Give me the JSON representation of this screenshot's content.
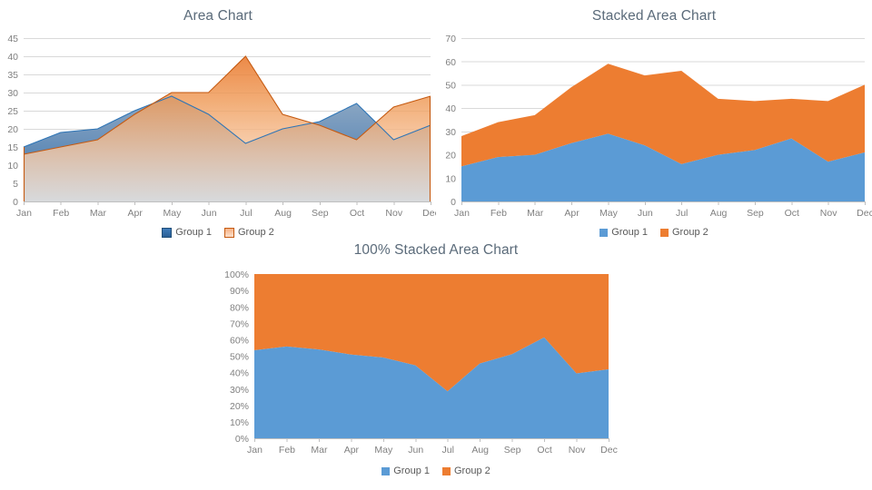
{
  "colors": {
    "series1_solid": "#5b9bd5",
    "series2_solid": "#ed7d31",
    "series1_line": "#2e75b6",
    "series2_line": "#c55a11",
    "grid": "#d9d9d9",
    "axis": "#bfbfbf",
    "title_text": "#5b6b7a",
    "tick_text": "#808080"
  },
  "charts": {
    "area": {
      "title": "Area Chart",
      "legend": [
        {
          "label": "Group 1",
          "swatch": "gradient-blue-swatch"
        },
        {
          "label": "Group 2",
          "swatch": "gradient-orange-swatch"
        }
      ]
    },
    "stacked": {
      "title": "Stacked Area Chart",
      "legend": [
        {
          "label": "Group 1",
          "swatch": "flat-blue-swatch"
        },
        {
          "label": "Group 2",
          "swatch": "flat-orange-swatch"
        }
      ]
    },
    "pct": {
      "title": "100% Stacked Area Chart",
      "legend": [
        {
          "label": "Group 1",
          "swatch": "flat-blue-swatch"
        },
        {
          "label": "Group 2",
          "swatch": "flat-orange-swatch"
        }
      ]
    }
  },
  "chart_data": [
    {
      "type": "area",
      "title": "Area Chart",
      "xlabel": "",
      "ylabel": "",
      "categories": [
        "Jan",
        "Feb",
        "Mar",
        "Apr",
        "May",
        "Jun",
        "Jul",
        "Aug",
        "Sep",
        "Oct",
        "Nov",
        "Dec"
      ],
      "series": [
        {
          "name": "Group 1",
          "values": [
            15,
            19,
            20,
            25,
            29,
            24,
            16,
            20,
            22,
            27,
            17,
            21
          ]
        },
        {
          "name": "Group 2",
          "values": [
            13,
            15,
            17,
            24,
            30,
            30,
            40,
            24,
            21,
            17,
            26,
            29
          ]
        }
      ],
      "ylim": [
        0,
        45
      ],
      "yticks": [
        0,
        5,
        10,
        15,
        20,
        25,
        30,
        35,
        40,
        45
      ],
      "ytick_labels": [
        "0",
        "5",
        "10",
        "15",
        "20",
        "25",
        "30",
        "35",
        "40",
        "45"
      ],
      "grid": true,
      "stacked": false,
      "legend_position": "bottom"
    },
    {
      "type": "area",
      "title": "Stacked Area Chart",
      "xlabel": "",
      "ylabel": "",
      "categories": [
        "Jan",
        "Feb",
        "Mar",
        "Apr",
        "May",
        "Jun",
        "Jul",
        "Aug",
        "Sep",
        "Oct",
        "Nov",
        "Dec"
      ],
      "series": [
        {
          "name": "Group 1",
          "values": [
            15,
            19,
            20,
            25,
            29,
            24,
            16,
            20,
            22,
            27,
            17,
            21
          ]
        },
        {
          "name": "Group 2",
          "values": [
            13,
            15,
            17,
            24,
            30,
            30,
            40,
            24,
            21,
            17,
            26,
            29
          ]
        }
      ],
      "stacked_totals": [
        28,
        34,
        37,
        49,
        59,
        54,
        56,
        44,
        43,
        44,
        43,
        50
      ],
      "ylim": [
        0,
        70
      ],
      "yticks": [
        0,
        10,
        20,
        30,
        40,
        50,
        60,
        70
      ],
      "ytick_labels": [
        "0",
        "10",
        "20",
        "30",
        "40",
        "50",
        "60",
        "70"
      ],
      "grid": true,
      "stacked": true,
      "legend_position": "bottom"
    },
    {
      "type": "area",
      "title": "100% Stacked Area Chart",
      "xlabel": "",
      "ylabel": "",
      "categories": [
        "Jan",
        "Feb",
        "Mar",
        "Apr",
        "May",
        "Jun",
        "Jul",
        "Aug",
        "Sep",
        "Oct",
        "Nov",
        "Dec"
      ],
      "series": [
        {
          "name": "Group 1",
          "values": [
            53.6,
            55.9,
            54.1,
            51.0,
            49.2,
            44.4,
            28.6,
            45.5,
            51.2,
            61.4,
            39.5,
            42.0
          ]
        },
        {
          "name": "Group 2",
          "values": [
            46.4,
            44.1,
            45.9,
            49.0,
            50.8,
            55.6,
            71.4,
            54.5,
            48.8,
            38.6,
            60.5,
            58.0
          ]
        }
      ],
      "ylim": [
        0,
        100
      ],
      "yticks": [
        0,
        10,
        20,
        30,
        40,
        50,
        60,
        70,
        80,
        90,
        100
      ],
      "ytick_labels": [
        "0%",
        "10%",
        "20%",
        "30%",
        "40%",
        "50%",
        "60%",
        "70%",
        "80%",
        "90%",
        "100%"
      ],
      "grid": false,
      "stacked": true,
      "normalized": true,
      "legend_position": "bottom"
    }
  ]
}
